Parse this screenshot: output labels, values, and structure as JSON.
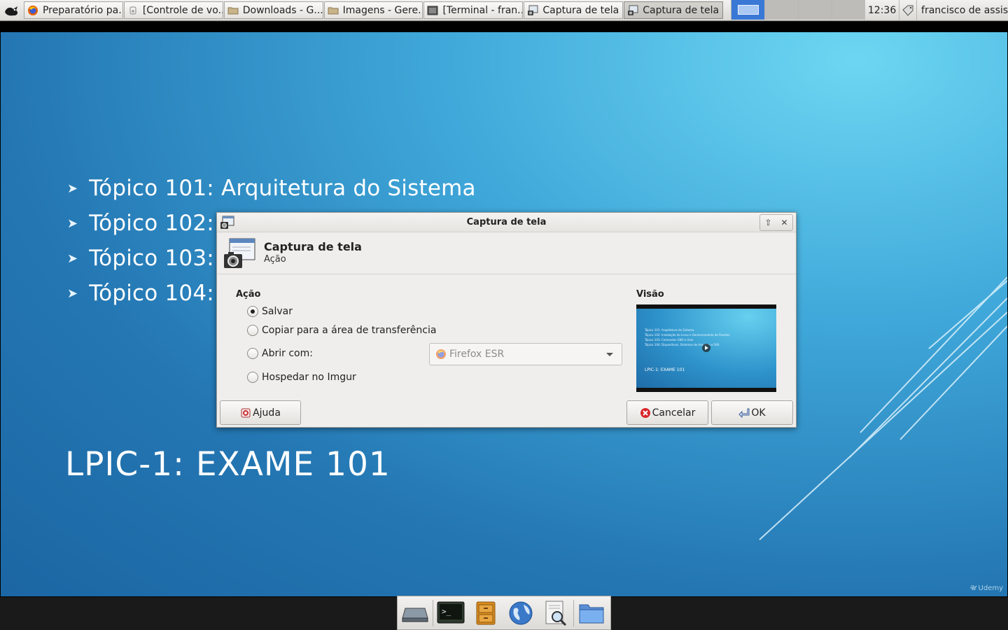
{
  "panel": {
    "tasks": [
      {
        "label": "Preparatório pa...",
        "icon": "firefox-icon"
      },
      {
        "label": "[Controle de vo...",
        "icon": "volume-control-icon"
      },
      {
        "label": "Downloads - G...",
        "icon": "folder-icon"
      },
      {
        "label": "Imagens - Gere...",
        "icon": "folder-icon"
      },
      {
        "label": "[Terminal - fran...",
        "icon": "terminal-icon"
      },
      {
        "label": "Captura de tela",
        "icon": "screenshot-icon"
      },
      {
        "label": "Captura de tela",
        "icon": "screenshot-icon"
      }
    ],
    "clock": "12:36",
    "user": "francisco de assis"
  },
  "slide": {
    "topics": [
      "Tópico 101: Arquitetura do Sistema",
      "Tópico 102:",
      "Tópico 103:",
      "Tópico 104:"
    ],
    "title": "LPIC-1: EXAME 101",
    "watermark": "Udemy"
  },
  "dialog": {
    "window_title": "Captura de tela",
    "header_title": "Captura de tela",
    "header_subtitle": "Ação",
    "action_label": "Ação",
    "options": [
      {
        "label": "Salvar",
        "checked": true
      },
      {
        "label": "Copiar para a área de transferência",
        "checked": false
      },
      {
        "label": "Abrir com:",
        "checked": false
      },
      {
        "label": "Hospedar no Imgur",
        "checked": false
      }
    ],
    "open_with_value": "Firefox ESR",
    "preview_label": "Visão",
    "preview": {
      "lines": [
        "Tópico 101: Arquitetura do Sistema",
        "Tópico 102: Instalação do Linux e Gerenciamento de Pacotes",
        "Tópico 103: Comandos GNU e Unix",
        "Tópico 104: Dispositivos, Sistemas de Arquivos e FHS"
      ],
      "title": "LPIC-1: EXAME 101"
    },
    "buttons": {
      "help": "Ajuda",
      "cancel": "Cancelar",
      "ok": "OK"
    }
  },
  "dock": {
    "items": [
      "drive-icon",
      "terminal-icon",
      "file-cabinet-icon",
      "web-browser-icon",
      "search-icon",
      "folder-icon"
    ]
  }
}
